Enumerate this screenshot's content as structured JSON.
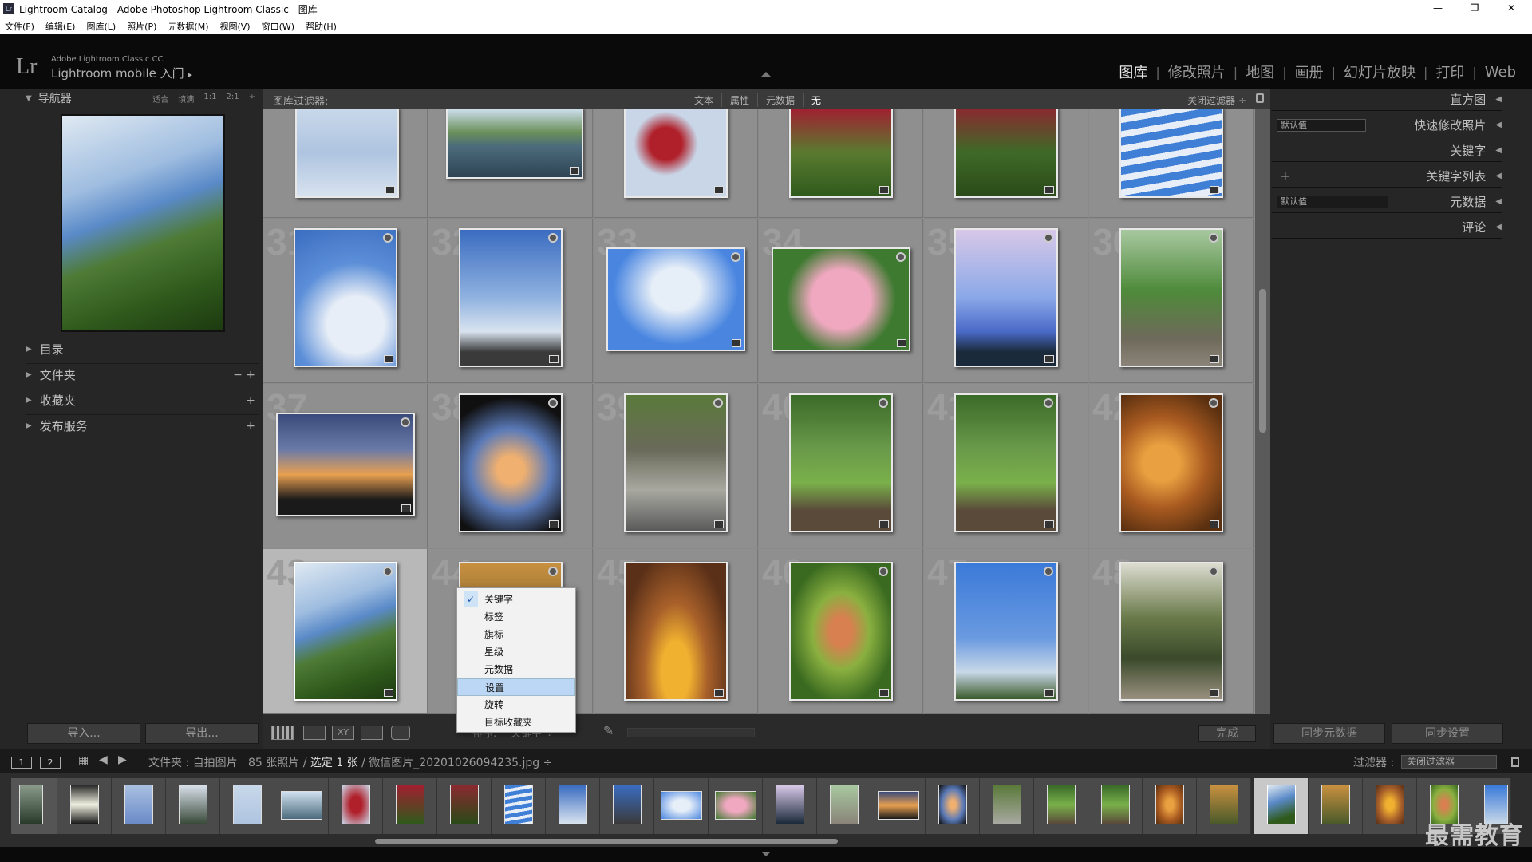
{
  "window": {
    "title": "Lightroom Catalog - Adobe Photoshop Lightroom Classic - 图库",
    "icon": "Lr",
    "min": "—",
    "restore": "❐",
    "close": "✕"
  },
  "menu": [
    "文件(F)",
    "编辑(E)",
    "图库(L)",
    "照片(P)",
    "元数据(M)",
    "视图(V)",
    "窗口(W)",
    "帮助(H)"
  ],
  "identity": {
    "logo": "Lr",
    "line1": "Adobe Lightroom Classic CC",
    "line2": "Lightroom mobile 入门",
    "arrow": "▸"
  },
  "modules": [
    "图库",
    "修改照片",
    "地图",
    "画册",
    "幻灯片放映",
    "打印",
    "Web"
  ],
  "active_module": "图库",
  "navigator": {
    "title": "导航器",
    "zooms": [
      "适合",
      "填满",
      "1:1",
      "2:1"
    ],
    "zoom_arrow": "÷"
  },
  "left_sections": [
    {
      "label": "目录",
      "ctrl": ""
    },
    {
      "label": "文件夹",
      "ctrl": "−  +"
    },
    {
      "label": "收藏夹",
      "ctrl": "+"
    },
    {
      "label": "发布服务",
      "ctrl": "+"
    }
  ],
  "left_buttons": {
    "import": "导入...",
    "export": "导出..."
  },
  "filter_bar": {
    "label": "图库过滤器:",
    "options": [
      "文本",
      "属性",
      "元数据",
      "无"
    ],
    "active": "无",
    "close": "关闭过滤器 ÷"
  },
  "grid_numbers": [
    [
      "",
      "",
      "",
      "",
      "",
      ""
    ],
    [
      "31",
      "32",
      "33",
      "34",
      "35",
      "36"
    ],
    [
      "37",
      "38",
      "39",
      "40",
      "41",
      "42"
    ],
    [
      "43",
      "44",
      "45",
      "46",
      "47",
      "48"
    ]
  ],
  "context_menu": {
    "items": [
      "关键字",
      "标签",
      "旗标",
      "星级",
      "元数据",
      "设置",
      "旋转",
      "目标收藏夹"
    ],
    "checked": "关键字",
    "highlighted": "设置",
    "check_mark": "✓"
  },
  "toolbar": {
    "sort_label": "排序:",
    "sort_value": "关键字 ÷",
    "done": "完成",
    "survey_label": "XY"
  },
  "right_sections": [
    {
      "label": "直方图",
      "dropdown": "",
      "plus": ""
    },
    {
      "label": "快速修改照片",
      "dropdown": "默认值",
      "plus": ""
    },
    {
      "label": "关键字",
      "dropdown": "",
      "plus": ""
    },
    {
      "label": "关键字列表",
      "dropdown": "",
      "plus": "+"
    },
    {
      "label": "元数据",
      "dropdown": "默认值",
      "plus": ""
    },
    {
      "label": "评论",
      "dropdown": "",
      "plus": ""
    }
  ],
  "right_buttons": {
    "sync_meta": "同步元数据",
    "sync_settings": "同步设置"
  },
  "statusbar": {
    "mon1": "1",
    "mon2": "2",
    "path_prefix": "文件夹 : 自拍图片",
    "count": "85 张照片 /",
    "selected": "选定 1 张",
    "filename": "/ 微信图片_20201026094235.jpg ÷",
    "filter_label": "过滤器 :",
    "filter_value": "关闭过滤器"
  },
  "watermark": "最需教育",
  "colors": {
    "accent_selection": "#bcd7f5",
    "panel_bg": "#262626",
    "grid_bg": "#8a8a8a"
  }
}
